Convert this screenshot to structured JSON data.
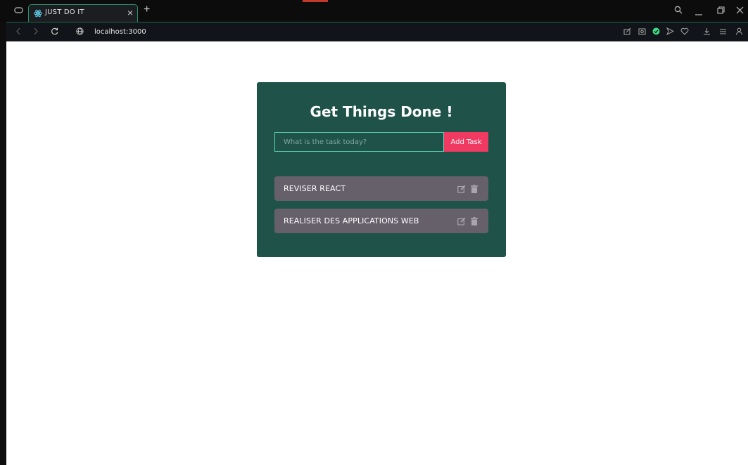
{
  "browser": {
    "tab_title": "JUST DO IT",
    "tab_close": "×",
    "new_tab": "+",
    "url": "localhost:3000"
  },
  "app": {
    "title": "Get Things Done !",
    "input_placeholder": "What is the task today?",
    "input_value": "",
    "add_button_label": "Add Task",
    "todos": [
      {
        "label": "REVISER REACT"
      },
      {
        "label": "REALISER DES APPLICATIONS WEB"
      }
    ]
  },
  "colors": {
    "card_bg": "#1f534a",
    "accent_button": "#f03a62",
    "todo_bg": "#66606a",
    "input_border": "#5fd0b6"
  }
}
